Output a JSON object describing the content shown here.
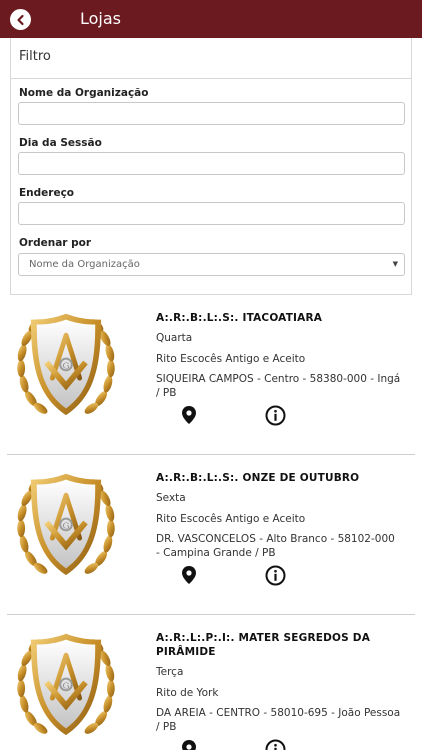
{
  "header": {
    "title": "Lojas",
    "back_icon": "chevron-left-icon"
  },
  "filter": {
    "title": "Filtro",
    "org_label": "Nome da Organização",
    "org_value": "",
    "day_label": "Dia da Sessão",
    "day_value": "",
    "address_label": "Endereço",
    "address_value": "",
    "order_label": "Ordenar por",
    "order_value": "Nome da Organização"
  },
  "lodges": [
    {
      "name": "A:.R:.B:.L:.S:. ITACOATIARA",
      "day": "Quarta",
      "rite": "Rito Escocês Antigo e Aceito",
      "address": "SIQUEIRA CAMPOS - Centro - 58380-000 - Ingá / PB"
    },
    {
      "name": "A:.R:.B:.L:.S:. ONZE DE OUTUBRO",
      "day": "Sexta",
      "rite": "Rito Escocês Antigo e Aceito",
      "address": "DR. VASCONCELOS - Alto Branco - 58102-000 - Campina Grande / PB"
    },
    {
      "name": "A:.R:.L:.P:.I:. MATER SEGREDOS DA PIRÂMIDE",
      "day": "Terça",
      "rite": "Rito de York",
      "address": "DA AREIA - CENTRO - 58010-695 - João Pessoa / PB"
    }
  ],
  "colors": {
    "header_bg": "#6b1a1f",
    "gold": "#c8902a"
  }
}
